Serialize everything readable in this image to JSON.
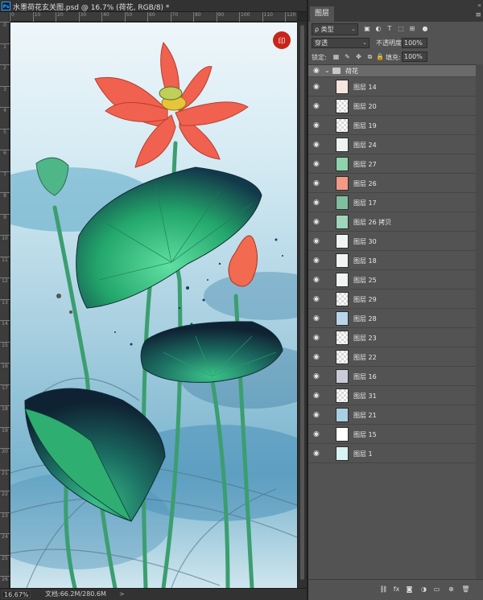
{
  "document": {
    "title": "水墨荷花玄关图.psd @ 16.7% (荷花, RGB/8) *",
    "ps_logo": "Ps",
    "ruler_h": [
      "0",
      "10",
      "20",
      "30",
      "40",
      "50",
      "60",
      "70",
      "80",
      "90",
      "100",
      "110",
      "120"
    ],
    "ruler_v": [
      "0",
      "1",
      "2",
      "3",
      "4",
      "5",
      "6",
      "7",
      "8",
      "9",
      "10",
      "11",
      "12",
      "13",
      "14",
      "15",
      "16",
      "17",
      "18",
      "19",
      "20",
      "21",
      "22",
      "23",
      "24",
      "25",
      "26"
    ],
    "status": {
      "zoom": "16.67%",
      "doc_size": "文档:66.2M/280.6M",
      "arrow": ">"
    }
  },
  "panel": {
    "tab_label": "图层",
    "close": "«",
    "menu": "≡",
    "filter": {
      "kind": "ρ 类型"
    },
    "blend_mode": "穿透",
    "opacity_label": "不透明度:",
    "opacity_value": "100%",
    "lock_label": "锁定:",
    "fill_label": "填充:",
    "fill_value": "100%",
    "group_name": "荷花",
    "layers": [
      {
        "name": "图层 14",
        "thumb": "seal"
      },
      {
        "name": "图层 20",
        "thumb": "blank"
      },
      {
        "name": "图层 19",
        "thumb": "blank"
      },
      {
        "name": "图层 24",
        "thumb": "stem"
      },
      {
        "name": "图层 27",
        "thumb": "leaf"
      },
      {
        "name": "图层 26",
        "thumb": "flower"
      },
      {
        "name": "图层 17",
        "thumb": "leaf-dark"
      },
      {
        "name": "图层 26 拷贝",
        "thumb": "leaf"
      },
      {
        "name": "图层 30",
        "thumb": "stem"
      },
      {
        "name": "图层 18",
        "thumb": "stem"
      },
      {
        "name": "图层 25",
        "thumb": "stem"
      },
      {
        "name": "图层 29",
        "thumb": "blank"
      },
      {
        "name": "图层 28",
        "thumb": "blue"
      },
      {
        "name": "图层 23",
        "thumb": "blank"
      },
      {
        "name": "图层 22",
        "thumb": "blank"
      },
      {
        "name": "图层 16",
        "thumb": "ink"
      },
      {
        "name": "图层 31",
        "thumb": "blank"
      },
      {
        "name": "图层 21",
        "thumb": "blue"
      },
      {
        "name": "图层 15",
        "thumb": "white"
      },
      {
        "name": "图层 1",
        "thumb": "cyan"
      }
    ],
    "footer_icons": [
      "link-icon",
      "fx-icon",
      "mask-icon",
      "adjustment-icon",
      "folder-icon",
      "new-layer-icon",
      "trash-icon"
    ]
  },
  "colors": {
    "panel_bg": "#535353",
    "app_bg": "#282828",
    "lotus": "#f0614f",
    "leaf": "#2fae72",
    "sky": "#b9dcea"
  }
}
